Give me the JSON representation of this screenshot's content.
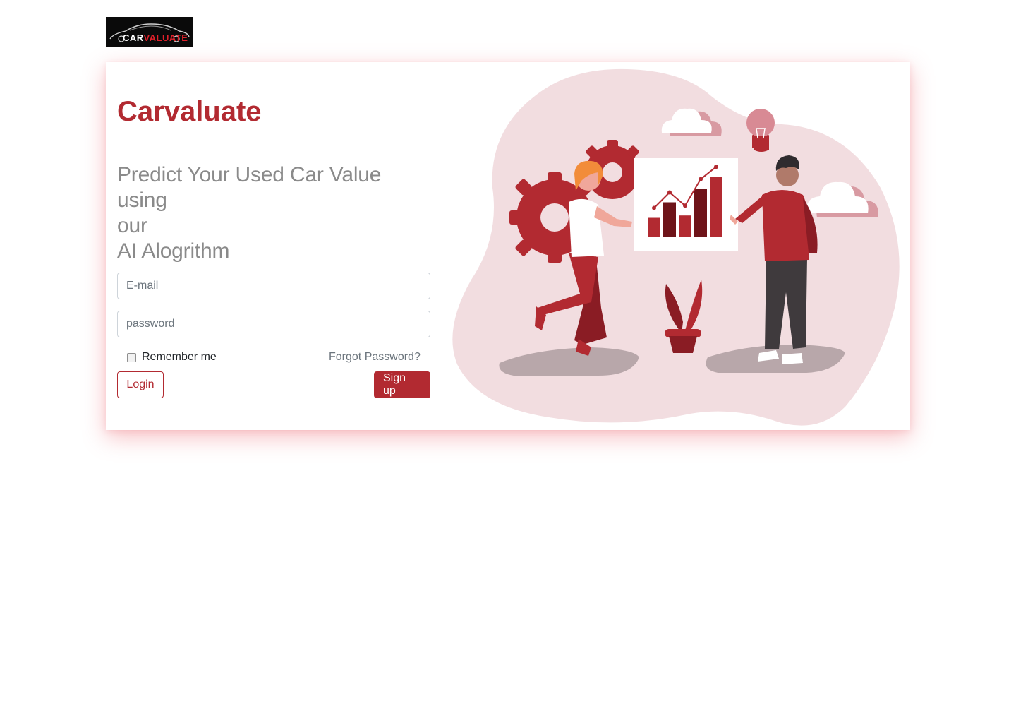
{
  "header": {
    "logo": {
      "text_part1": "CAR",
      "text_part2": "VALUATE",
      "icon": "car-silhouette-icon"
    }
  },
  "hero": {
    "title": "Carvaluate",
    "tagline_lines": [
      "Predict Your Used Car Value using",
      "our",
      "AI Alogrithm"
    ]
  },
  "form": {
    "email": {
      "placeholder": "E-mail",
      "value": ""
    },
    "password": {
      "placeholder": "password",
      "value": ""
    },
    "remember_label": "Remember me",
    "remember_checked": false,
    "forgot_label": "Forgot Password?",
    "login_label": "Login",
    "signup_label": "Sign up"
  },
  "illustration": {
    "icons": [
      "gear-icon",
      "cloud-icon",
      "lightbulb-icon",
      "bar-chart-icon",
      "plant-icon"
    ],
    "chart_bars": [
      0.25,
      0.45,
      0.28,
      0.62,
      0.78
    ],
    "colors": {
      "blob": "#f2dde0",
      "accent": "#b22a31",
      "dark_accent": "#8a1c24"
    }
  },
  "colors": {
    "accent": "#b22a31",
    "muted_text": "#8a8a8a"
  }
}
